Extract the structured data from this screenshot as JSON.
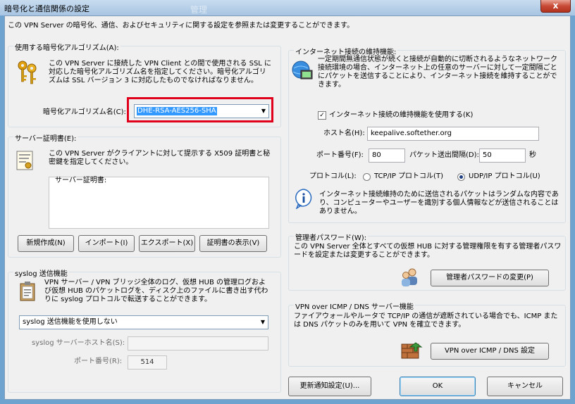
{
  "window": {
    "title": "暗号化と通信関係の設定",
    "background_caption": "管理",
    "close_glyph": "x"
  },
  "intro": "この VPN Server の暗号化、通信、およびセキュリティに関する設定を参照または変更することができます。",
  "encryption": {
    "group_label": "使用する暗号化アルゴリズム(A):",
    "description": "この VPN Server に接続した VPN Client との間で使用される SSL に対応した暗号化アルゴリズム名を指定してください。暗号化アルゴリズムは SSL バージョン 3 に対応したものでなければなりません。",
    "algorithm_label": "暗号化アルゴリズム名(C):",
    "algorithm_value": "DHE-RSA-AES256-SHA",
    "highlight_color": "#e0001b"
  },
  "certificate": {
    "group_label": "サーバー証明書(E):",
    "description": "この VPN Server がクライアントに対して提示する X509 証明書と秘密鍵を指定してください。",
    "box_label": "サーバー証明書:",
    "buttons": {
      "new": "新規作成(N)",
      "import": "インポート(I)",
      "export": "エクスポート(X)",
      "view": "証明書の表示(V)"
    }
  },
  "syslog": {
    "group_label": "syslog 送信機能",
    "description": "VPN サーバー / VPN ブリッジ全体のログ、仮想 HUB の管理ログおよび仮想 HUB のパケットログを、ディスク上のファイルに書き出す代わりに syslog プロトコルで転送することができます。",
    "mode_value": "syslog 送信機能を使用しない",
    "host_label": "syslog サーバーホスト名(S):",
    "host_value": "",
    "port_label": "ポート番号(R):",
    "port_value": "514"
  },
  "keepalive": {
    "group_label": "インターネット接続の維持機能:",
    "description": "一定期間無通信状態が続くと接続が自動的に切断されるようなネットワーク接続環境の場合、インターネット上の任意のサーバーに対して一定間隔ごとにパケットを送信することにより、インターネット接続を維持することができます。",
    "enable_label": "インターネット接続の維持機能を使用する(K)",
    "enable_checked": true,
    "host_label": "ホスト名(H):",
    "host_value": "keepalive.softether.org",
    "port_label": "ポート番号(F):",
    "port_value": "80",
    "interval_label": "パケット送出間隔(D):",
    "interval_value": "50",
    "interval_unit": "秒",
    "protocol_label": "プロトコル(L):",
    "tcp_label": "TCP/IP プロトコル(T)",
    "udp_label": "UDP/IP プロトコル(U)",
    "selected_protocol": "udp",
    "info": "インターネット接続維持のために送信されるパケットはランダムな内容であり、コンピューターやユーザーを識別する個人情報などが送信されることはありません。"
  },
  "admin": {
    "group_label": "管理者パスワード(W):",
    "description": "この VPN Server 全体とすべての仮想 HUB に対する管理権限を有する管理者パスワードを設定または変更することができます。",
    "button": "管理者パスワードの変更(P)"
  },
  "icmp": {
    "group_label": "VPN over ICMP / DNS サーバー機能",
    "description": "ファイアウォールやルータで TCP/IP の通信が遮断されている場合でも、ICMP または DNS パケットのみを用いて VPN を確立できます。",
    "button": "VPN over ICMP / DNS 設定"
  },
  "footer": {
    "update": "更新通知設定(U)...",
    "ok": "OK",
    "cancel": "キャンセル"
  }
}
